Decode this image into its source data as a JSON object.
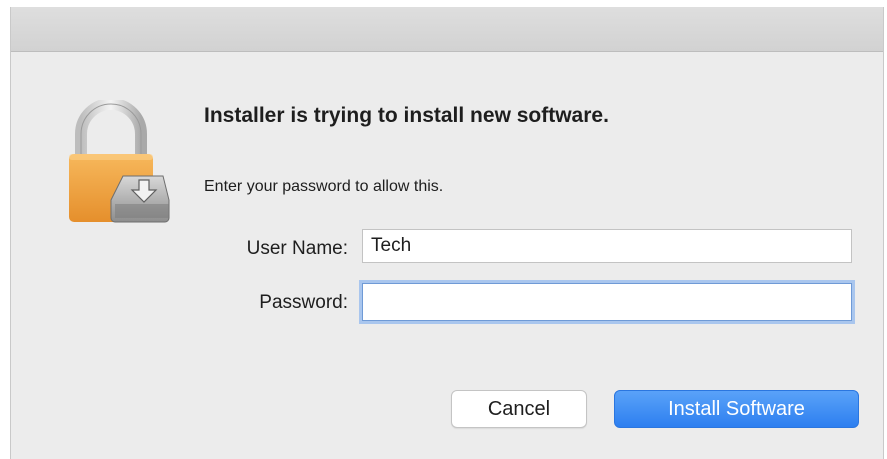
{
  "dialog": {
    "heading": "Installer is trying to install new software.",
    "subtext": "Enter your password to allow this.",
    "icon": "lock-install-icon"
  },
  "form": {
    "username_label": "User Name:",
    "username_value": "Tech",
    "password_label": "Password:",
    "password_value": ""
  },
  "buttons": {
    "cancel_label": "Cancel",
    "install_label": "Install Software"
  },
  "colors": {
    "accent": "#2d7ff0",
    "lock_gold": "#f0a64a",
    "focus_ring": "#a9c6ee"
  }
}
